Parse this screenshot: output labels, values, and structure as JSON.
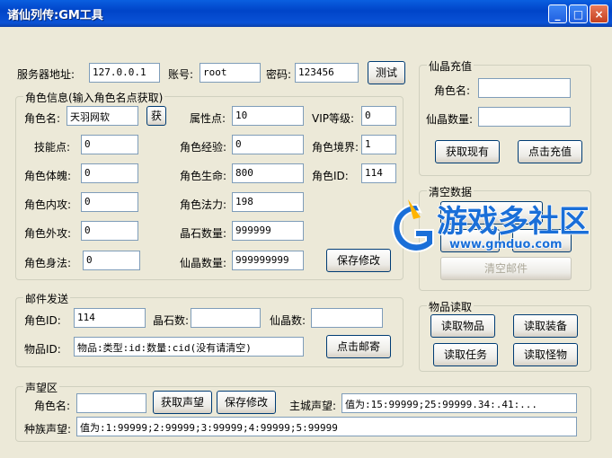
{
  "window": {
    "title": "诸仙列传:GM工具",
    "minimize": "_",
    "maximize": "□",
    "close": "×"
  },
  "server": {
    "address_label": "服务器地址:",
    "address_value": "127.0.0.1",
    "account_label": "账号:",
    "account_value": "root",
    "password_label": "密码:",
    "password_value": "123456",
    "test_button": "测试"
  },
  "role_info": {
    "group_title": "角色信息(输入角色名点获取)",
    "name_label": "角色名:",
    "name_value": "天羽网软",
    "get_button": "获",
    "attr_points_label": "属性点:",
    "attr_points_value": "10",
    "vip_label": "VIP等级:",
    "vip_value": "0",
    "skill_points_label": "技能点:",
    "skill_points_value": "0",
    "exp_label": "角色经验:",
    "exp_value": "0",
    "realm_label": "角色境界:",
    "realm_value": "1",
    "physique_label": "角色体魄:",
    "physique_value": "0",
    "life_label": "角色生命:",
    "life_value": "800",
    "id_label": "角色ID:",
    "id_value": "114",
    "inner_atk_label": "角色内攻:",
    "inner_atk_value": "0",
    "mana_label": "角色法力:",
    "mana_value": "198",
    "outer_atk_label": "角色外攻:",
    "outer_atk_value": "0",
    "crystal_label": "晶石数量:",
    "crystal_value": "999999",
    "body_label": "角色身法:",
    "body_value": "0",
    "jade_label": "仙晶数量:",
    "jade_value": "999999999",
    "save_button": "保存修改"
  },
  "recharge": {
    "group_title": "仙晶充值",
    "name_label": "角色名:",
    "name_value": "",
    "amount_label": "仙晶数量:",
    "amount_value": "",
    "get_current_button": "获取现有",
    "recharge_button": "点击充值"
  },
  "clear_data": {
    "group_title": "清空数据",
    "clear_mail_button": "清空邮件"
  },
  "mail": {
    "group_title": "邮件发送",
    "role_id_label": "角色ID:",
    "role_id_value": "114",
    "crystal_label": "晶石数:",
    "crystal_value": "",
    "jade_label": "仙晶数:",
    "jade_value": "",
    "item_id_label": "物品ID:",
    "item_id_value": "物品:类型:id:数量:cid(没有请清空)",
    "send_button": "点击邮寄"
  },
  "item_read": {
    "group_title": "物品读取",
    "read_items": "读取物品",
    "read_equipment": "读取装备",
    "read_tasks": "读取任务",
    "read_monsters": "读取怪物"
  },
  "reputation": {
    "group_title": "声望区",
    "name_label": "角色名:",
    "name_value": "",
    "get_button": "获取声望",
    "save_button": "保存修改",
    "city_label": "主城声望:",
    "city_value": "值为:15:99999;25:99999.34:.41:...",
    "race_label": "种族声望:",
    "race_value": "值为:1:99999;2:99999;3:99999;4:99999;5:99999"
  },
  "watermark": {
    "brand": "游戏多社区",
    "url": "www.gmduo.com"
  },
  "colors": {
    "title_bar": "#0a52d6",
    "window_bg": "#ece9d8",
    "input_border": "#7f9db9",
    "watermark_blue": "#1a6fd8"
  }
}
